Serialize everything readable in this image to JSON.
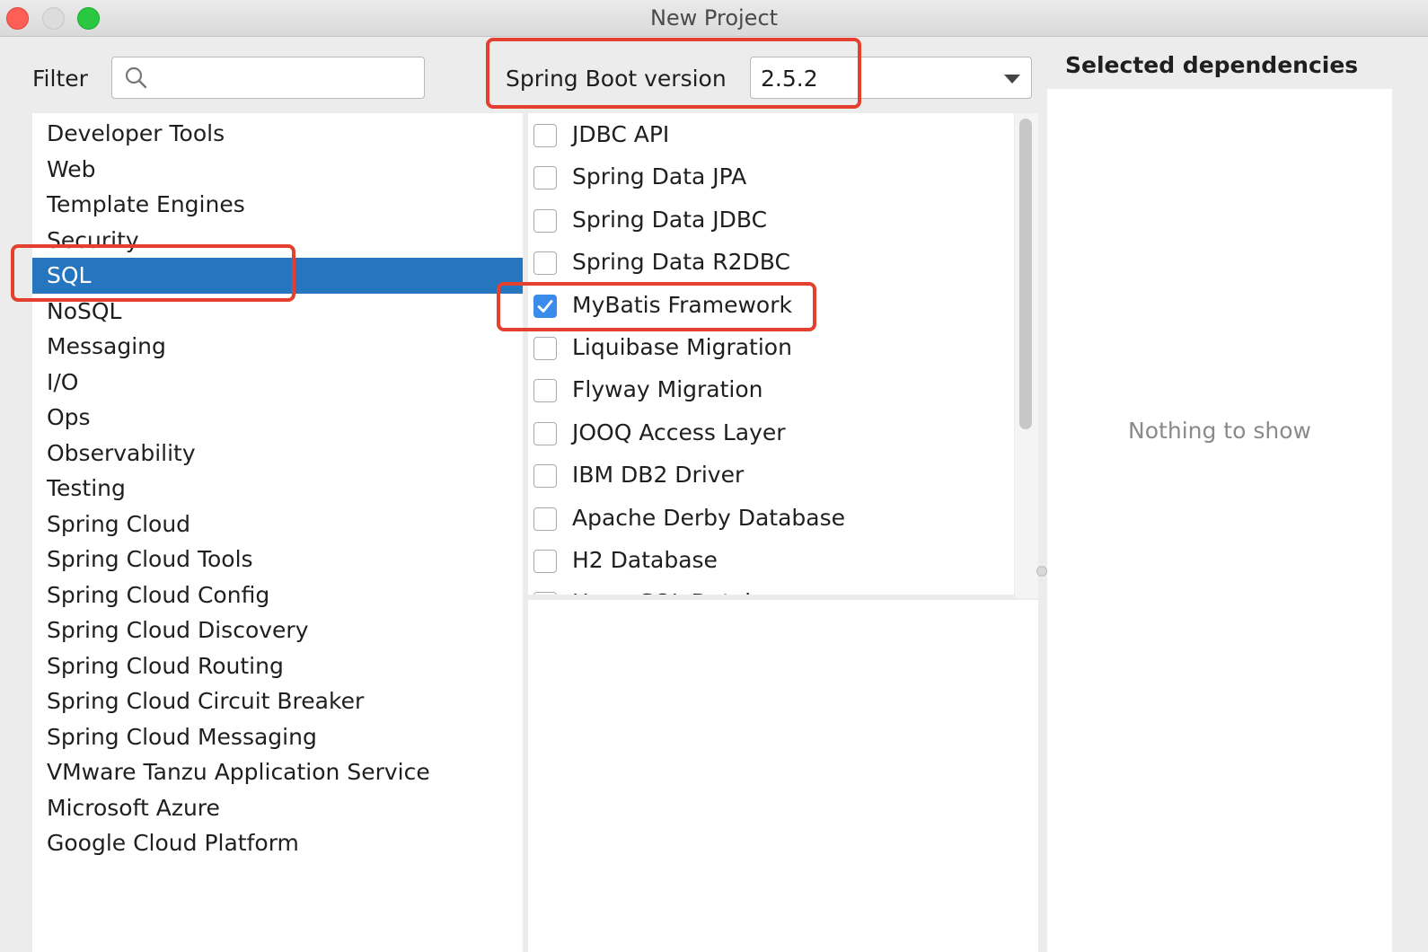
{
  "window": {
    "title": "New Project"
  },
  "filter": {
    "label": "Filter",
    "value": "",
    "placeholder": ""
  },
  "spring_boot": {
    "label": "Spring Boot version",
    "value": "2.5.2"
  },
  "selected": {
    "heading": "Selected dependencies",
    "empty_text": "Nothing to show"
  },
  "categories": [
    "Developer Tools",
    "Web",
    "Template Engines",
    "Security",
    "SQL",
    "NoSQL",
    "Messaging",
    "I/O",
    "Ops",
    "Observability",
    "Testing",
    "Spring Cloud",
    "Spring Cloud Tools",
    "Spring Cloud Config",
    "Spring Cloud Discovery",
    "Spring Cloud Routing",
    "Spring Cloud Circuit Breaker",
    "Spring Cloud Messaging",
    "VMware Tanzu Application Service",
    "Microsoft Azure",
    "Google Cloud Platform"
  ],
  "selected_category": "SQL",
  "dependencies": [
    {
      "label": "JDBC API",
      "checked": false
    },
    {
      "label": "Spring Data JPA",
      "checked": false
    },
    {
      "label": "Spring Data JDBC",
      "checked": false
    },
    {
      "label": "Spring Data R2DBC",
      "checked": false
    },
    {
      "label": "MyBatis Framework",
      "checked": true
    },
    {
      "label": "Liquibase Migration",
      "checked": false
    },
    {
      "label": "Flyway Migration",
      "checked": false
    },
    {
      "label": "JOOQ Access Layer",
      "checked": false
    },
    {
      "label": "IBM DB2 Driver",
      "checked": false
    },
    {
      "label": "Apache Derby Database",
      "checked": false
    },
    {
      "label": "H2 Database",
      "checked": false
    },
    {
      "label": "HyperSQL Database",
      "checked": false
    }
  ],
  "colors": {
    "selection": "#2675bf",
    "checkbox_checked": "#3a8bea",
    "annotation": "#e3402f"
  }
}
